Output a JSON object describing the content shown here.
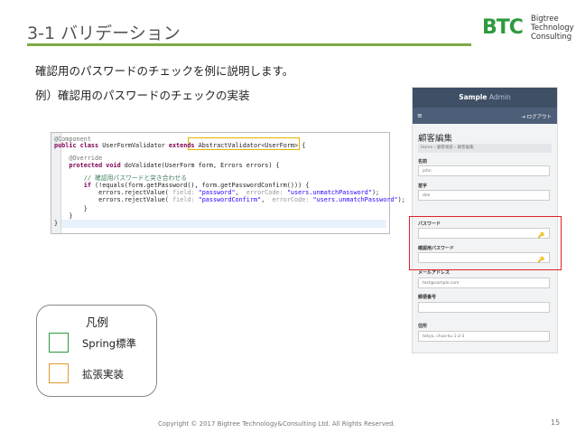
{
  "slide": {
    "title": "3-1 バリデーション",
    "line1": "確認用のパスワードのチェックを例に説明します。",
    "line2": "例）確認用のパスワードのチェックの実装",
    "footer": "Copyright © 2017 Bigtree Technology&Consulting Ltd. All Rights Reserved.",
    "page_number": "15"
  },
  "logo": {
    "letters": "BTC",
    "line1": "Bigtree",
    "line2": "Technology",
    "line3": "Consulting",
    "color": "#2e9a3f"
  },
  "code": {
    "l1": "@Component",
    "l2a": "public class ",
    "l2b": "UserFormValidator ",
    "l2c": "extends ",
    "l2d": "AbstractValidator<UserForm> {",
    "l3": "    @Override",
    "l4a": "    protected void ",
    "l4b": "doValidate(UserForm form, Errors errors) {",
    "l5": "        // 確認用パスワードと突き合わせる",
    "l6a": "        if ",
    "l6b": "(!equals(form.getPassword(), form.getPasswordConfirm())) {",
    "l7a": "            errors.rejectValue( ",
    "l7b": "field: ",
    "l7c": "\"password\"",
    "l7d": ",  ",
    "l7e": "errorCode: ",
    "l7f": "\"users.unmatchPassword\"",
    "l7g": ");",
    "l8a": "            errors.rejectValue( ",
    "l8b": "field: ",
    "l8c": "\"passwordConfirm\"",
    "l8d": ",  ",
    "l8e": "errorCode: ",
    "l8f": "\"users.unmatchPassword\"",
    "l8g": ");",
    "l9": "        }",
    "l10": "    }",
    "l11": "}"
  },
  "legend": {
    "title": "凡例",
    "items": [
      {
        "label": "Spring標準",
        "color": "#2e9a3f"
      },
      {
        "label": "拡張実装",
        "color": "#e09a2e"
      }
    ]
  },
  "admin": {
    "brand_bold": "Sample",
    "brand_light": " Admin",
    "menu_icon": "≡",
    "logout": "⇥ ログアウト",
    "heading": "顧客編集",
    "breadcrumb": "Home  ›  顧客検索  ›  顧客編集",
    "fields": [
      {
        "label": "名前",
        "value": "john"
      },
      {
        "label": "苗字",
        "value": "doe"
      },
      {
        "label": "パスワード",
        "value": ""
      },
      {
        "label": "確認用パスワード",
        "value": ""
      },
      {
        "label": "メールアドレス",
        "value": "test@sample.com"
      },
      {
        "label": "郵便番号",
        "value": ""
      },
      {
        "label": "住所",
        "value": "tokyo, chuo-ku 1-2-3"
      }
    ],
    "key_icon": "🔑"
  },
  "colors": {
    "title_rule": "#7dab45",
    "highlight_red": "#e02222",
    "highlight_yellow": "#e3b400"
  }
}
